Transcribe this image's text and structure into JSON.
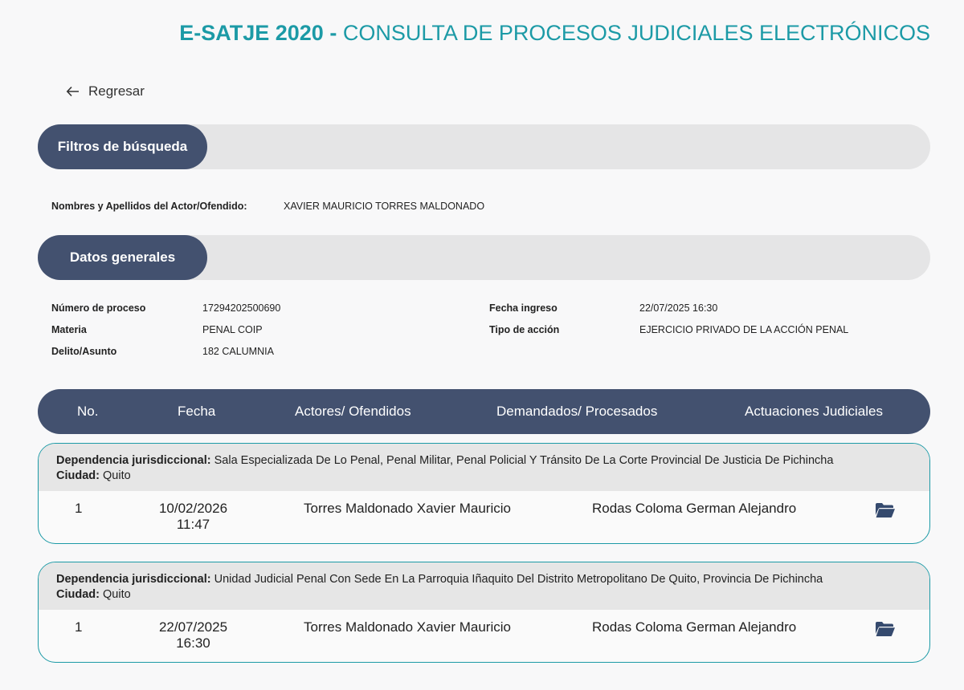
{
  "header": {
    "title_bold": "E-SATJE 2020 -",
    "title_rest": "CONSULTA DE PROCESOS JUDICIALES ELECTRÓNICOS",
    "accent_color": "#1c9aa6"
  },
  "nav": {
    "back_label": "Regresar",
    "back_icon": "arrow-left-icon"
  },
  "filters": {
    "section_title": "Filtros de búsqueda",
    "actor_label": "Nombres y Apellidos del Actor/Ofendido:",
    "actor_value": "XAVIER MAURICIO TORRES MALDONADO"
  },
  "general": {
    "section_title": "Datos generales",
    "numero_label": "Número de proceso",
    "numero_value": "17294202500690",
    "materia_label": "Materia",
    "materia_value": "PENAL COIP",
    "delito_label": "Delito/Asunto",
    "delito_value": "182 CALUMNIA",
    "fecha_label": "Fecha ingreso",
    "fecha_value": "22/07/2025 16:30",
    "accion_label": "Tipo de acción",
    "accion_value": "EJERCICIO PRIVADO DE LA ACCIÓN PENAL"
  },
  "table": {
    "columns": [
      "No.",
      "Fecha",
      "Actores/ Ofendidos",
      "Demandados/ Procesados",
      "Actuaciones Judiciales"
    ],
    "header_color": "#43516f",
    "dependencia_label": "Dependencia jurisdiccional:",
    "ciudad_label": "Ciudad:",
    "records": [
      {
        "dependencia": "Sala Especializada De Lo Penal, Penal Militar, Penal Policial Y Tránsito De La Corte Provincial De Justicia De Pichincha",
        "ciudad": "Quito",
        "no": "1",
        "fecha_date": "10/02/2026",
        "fecha_time": "11:47",
        "actor": "Torres Maldonado Xavier Mauricio",
        "demandado": "Rodas Coloma German Alejandro",
        "action_icon": "folder-open-icon"
      },
      {
        "dependencia": "Unidad Judicial Penal Con Sede En La Parroquia Iñaquito Del Distrito Metropolitano De Quito, Provincia De Pichincha",
        "ciudad": "Quito",
        "no": "1",
        "fecha_date": "22/07/2025",
        "fecha_time": "16:30",
        "actor": "Torres Maldonado Xavier Mauricio",
        "demandado": "Rodas Coloma German Alejandro",
        "action_icon": "folder-open-icon"
      }
    ]
  }
}
